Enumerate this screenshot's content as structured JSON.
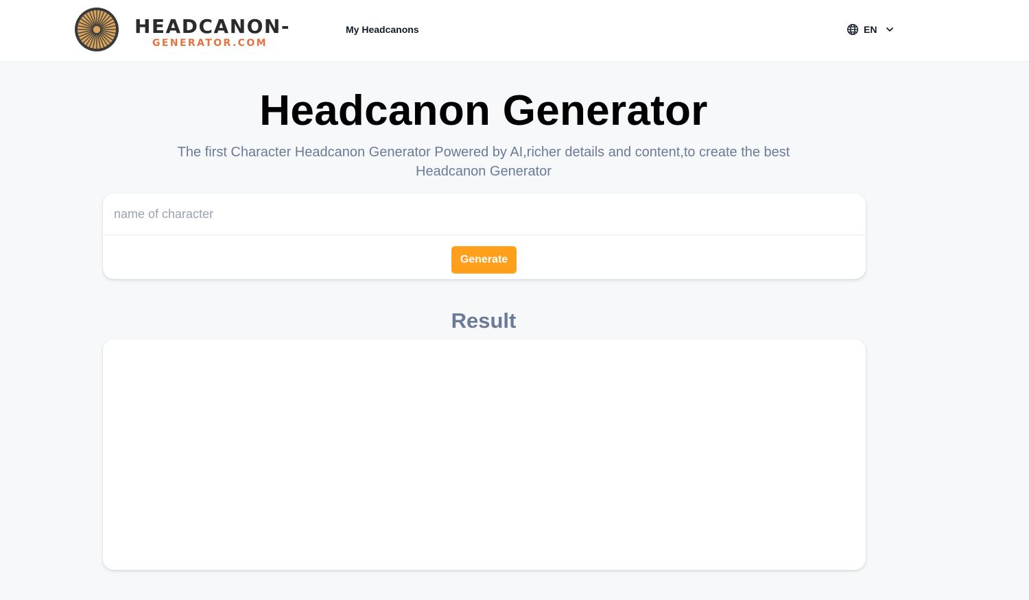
{
  "header": {
    "brand_top": "HEADCANON-",
    "brand_bottom": "GENERATOR.COM",
    "nav": {
      "my_headcanons": "My Headcanons"
    },
    "language": {
      "code": "EN",
      "icon": "globe-icon",
      "dropdown_icon": "chevron-down-icon"
    },
    "logo_icon": "sunburst-logo-icon"
  },
  "hero": {
    "title": "Headcanon Generator",
    "subtitle": "The first Character Headcanon Generator Powered by AI,richer details and content,to create the best Headcanon Generator"
  },
  "form": {
    "input_value": "",
    "input_placeholder": "name of character",
    "generate_label": "Generate"
  },
  "result": {
    "title": "Result",
    "content": ""
  },
  "colors": {
    "accent": "#ff9f1c",
    "brand_orange": "#e4733f",
    "muted_text": "#6b7a99",
    "page_background": "#f7f8fa"
  }
}
